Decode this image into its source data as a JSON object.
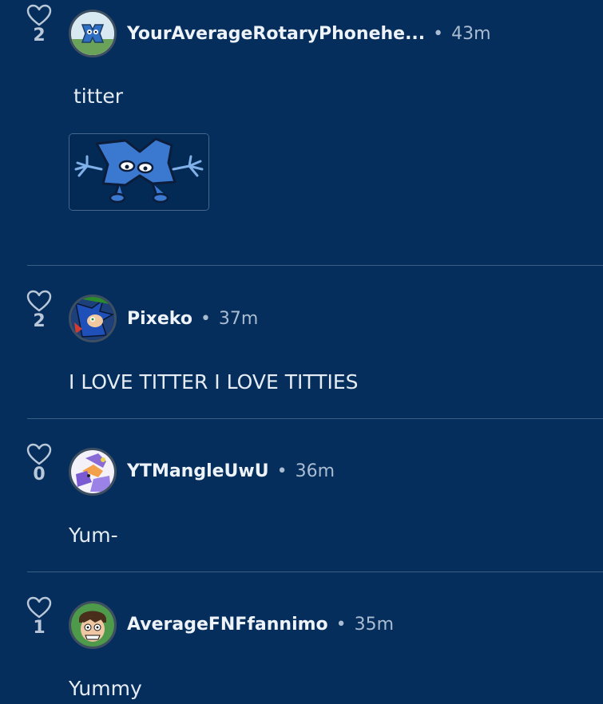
{
  "comments": [
    {
      "likes": "2",
      "username": "YourAverageRotaryPhonehe...",
      "separator": "•",
      "time": "43m",
      "text": "titter",
      "attachment": "four-character-image"
    },
    {
      "likes": "2",
      "username": "Pixeko",
      "separator": "•",
      "time": "37m",
      "text": "I LOVE TITTER I LOVE TITTIES"
    },
    {
      "likes": "0",
      "username": "YTMangleUwU",
      "separator": "•",
      "time": "36m",
      "text": "Yum-"
    },
    {
      "likes": "1",
      "username": "AverageFNFfannimo",
      "separator": "•",
      "time": "35m",
      "text": "Yummy"
    }
  ],
  "colors": {
    "background": "#052e5c",
    "divider": "#3b5f87",
    "text": "#e6ecf3",
    "muted": "#a9bcd1"
  }
}
